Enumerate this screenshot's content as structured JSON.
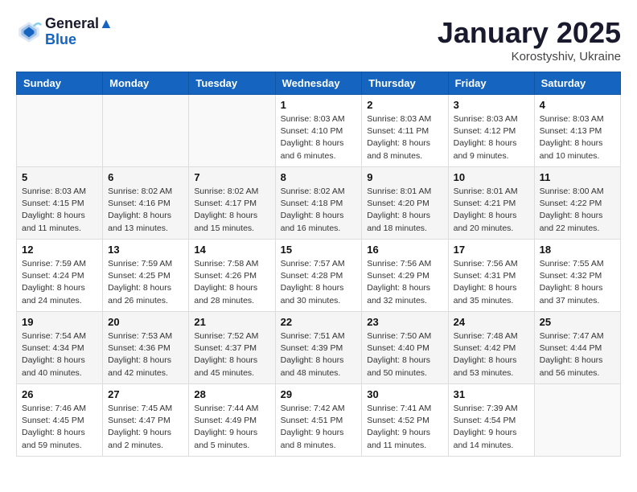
{
  "header": {
    "logo_line1": "General",
    "logo_line2": "Blue",
    "month_title": "January 2025",
    "location": "Korostyshiv, Ukraine"
  },
  "days_of_week": [
    "Sunday",
    "Monday",
    "Tuesday",
    "Wednesday",
    "Thursday",
    "Friday",
    "Saturday"
  ],
  "weeks": [
    [
      {
        "num": "",
        "detail": ""
      },
      {
        "num": "",
        "detail": ""
      },
      {
        "num": "",
        "detail": ""
      },
      {
        "num": "1",
        "detail": "Sunrise: 8:03 AM\nSunset: 4:10 PM\nDaylight: 8 hours and 6 minutes."
      },
      {
        "num": "2",
        "detail": "Sunrise: 8:03 AM\nSunset: 4:11 PM\nDaylight: 8 hours and 8 minutes."
      },
      {
        "num": "3",
        "detail": "Sunrise: 8:03 AM\nSunset: 4:12 PM\nDaylight: 8 hours and 9 minutes."
      },
      {
        "num": "4",
        "detail": "Sunrise: 8:03 AM\nSunset: 4:13 PM\nDaylight: 8 hours and 10 minutes."
      }
    ],
    [
      {
        "num": "5",
        "detail": "Sunrise: 8:03 AM\nSunset: 4:15 PM\nDaylight: 8 hours and 11 minutes."
      },
      {
        "num": "6",
        "detail": "Sunrise: 8:02 AM\nSunset: 4:16 PM\nDaylight: 8 hours and 13 minutes."
      },
      {
        "num": "7",
        "detail": "Sunrise: 8:02 AM\nSunset: 4:17 PM\nDaylight: 8 hours and 15 minutes."
      },
      {
        "num": "8",
        "detail": "Sunrise: 8:02 AM\nSunset: 4:18 PM\nDaylight: 8 hours and 16 minutes."
      },
      {
        "num": "9",
        "detail": "Sunrise: 8:01 AM\nSunset: 4:20 PM\nDaylight: 8 hours and 18 minutes."
      },
      {
        "num": "10",
        "detail": "Sunrise: 8:01 AM\nSunset: 4:21 PM\nDaylight: 8 hours and 20 minutes."
      },
      {
        "num": "11",
        "detail": "Sunrise: 8:00 AM\nSunset: 4:22 PM\nDaylight: 8 hours and 22 minutes."
      }
    ],
    [
      {
        "num": "12",
        "detail": "Sunrise: 7:59 AM\nSunset: 4:24 PM\nDaylight: 8 hours and 24 minutes."
      },
      {
        "num": "13",
        "detail": "Sunrise: 7:59 AM\nSunset: 4:25 PM\nDaylight: 8 hours and 26 minutes."
      },
      {
        "num": "14",
        "detail": "Sunrise: 7:58 AM\nSunset: 4:26 PM\nDaylight: 8 hours and 28 minutes."
      },
      {
        "num": "15",
        "detail": "Sunrise: 7:57 AM\nSunset: 4:28 PM\nDaylight: 8 hours and 30 minutes."
      },
      {
        "num": "16",
        "detail": "Sunrise: 7:56 AM\nSunset: 4:29 PM\nDaylight: 8 hours and 32 minutes."
      },
      {
        "num": "17",
        "detail": "Sunrise: 7:56 AM\nSunset: 4:31 PM\nDaylight: 8 hours and 35 minutes."
      },
      {
        "num": "18",
        "detail": "Sunrise: 7:55 AM\nSunset: 4:32 PM\nDaylight: 8 hours and 37 minutes."
      }
    ],
    [
      {
        "num": "19",
        "detail": "Sunrise: 7:54 AM\nSunset: 4:34 PM\nDaylight: 8 hours and 40 minutes."
      },
      {
        "num": "20",
        "detail": "Sunrise: 7:53 AM\nSunset: 4:36 PM\nDaylight: 8 hours and 42 minutes."
      },
      {
        "num": "21",
        "detail": "Sunrise: 7:52 AM\nSunset: 4:37 PM\nDaylight: 8 hours and 45 minutes."
      },
      {
        "num": "22",
        "detail": "Sunrise: 7:51 AM\nSunset: 4:39 PM\nDaylight: 8 hours and 48 minutes."
      },
      {
        "num": "23",
        "detail": "Sunrise: 7:50 AM\nSunset: 4:40 PM\nDaylight: 8 hours and 50 minutes."
      },
      {
        "num": "24",
        "detail": "Sunrise: 7:48 AM\nSunset: 4:42 PM\nDaylight: 8 hours and 53 minutes."
      },
      {
        "num": "25",
        "detail": "Sunrise: 7:47 AM\nSunset: 4:44 PM\nDaylight: 8 hours and 56 minutes."
      }
    ],
    [
      {
        "num": "26",
        "detail": "Sunrise: 7:46 AM\nSunset: 4:45 PM\nDaylight: 8 hours and 59 minutes."
      },
      {
        "num": "27",
        "detail": "Sunrise: 7:45 AM\nSunset: 4:47 PM\nDaylight: 9 hours and 2 minutes."
      },
      {
        "num": "28",
        "detail": "Sunrise: 7:44 AM\nSunset: 4:49 PM\nDaylight: 9 hours and 5 minutes."
      },
      {
        "num": "29",
        "detail": "Sunrise: 7:42 AM\nSunset: 4:51 PM\nDaylight: 9 hours and 8 minutes."
      },
      {
        "num": "30",
        "detail": "Sunrise: 7:41 AM\nSunset: 4:52 PM\nDaylight: 9 hours and 11 minutes."
      },
      {
        "num": "31",
        "detail": "Sunrise: 7:39 AM\nSunset: 4:54 PM\nDaylight: 9 hours and 14 minutes."
      },
      {
        "num": "",
        "detail": ""
      }
    ]
  ]
}
